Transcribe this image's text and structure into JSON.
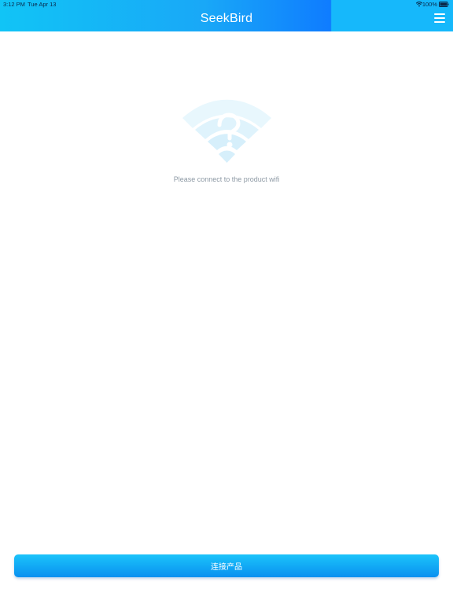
{
  "status_bar": {
    "time": "3:12 PM",
    "date": "Tue Apr 13",
    "battery": "100%",
    "wifi_icon": "wifi-icon",
    "battery_icon": "battery-full-icon"
  },
  "header": {
    "title": "SeekBird",
    "menu_icon": "hamburger-menu-icon"
  },
  "main": {
    "icon": "wifi-question-icon",
    "message": "Please connect to the product wifi"
  },
  "footer": {
    "connect_label": "连接产品"
  },
  "colors": {
    "header_start": "#11c4f6",
    "header_end": "#0f7cff",
    "button_start": "#1cc4fa",
    "button_end": "#0990f0",
    "empty_icon": "#dff3fc",
    "message_text": "#8e9aa5"
  }
}
